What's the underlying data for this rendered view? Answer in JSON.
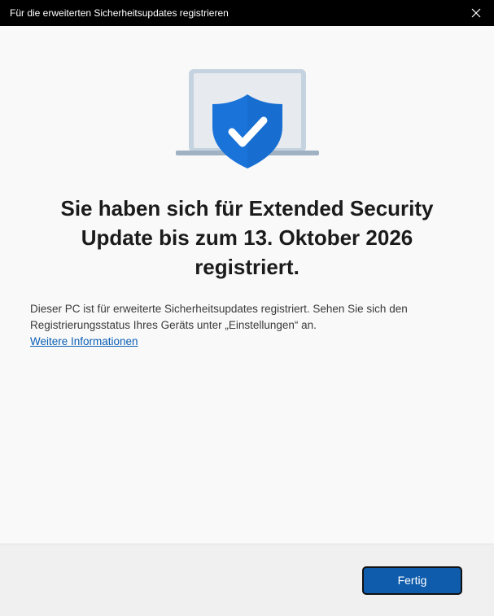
{
  "window": {
    "title": "Für die erweiterten Sicherheitsupdates registrieren",
    "close_icon": "close-icon"
  },
  "hero": {
    "icon": "laptop-shield-check-icon",
    "colors": {
      "shield": "#1a73d9",
      "laptop_frame": "#b9c9d8",
      "check": "#ffffff"
    }
  },
  "main": {
    "headline": "Sie haben sich für Extended Security Update bis zum 13. Oktober 2026 registriert.",
    "description": "Dieser PC ist für erweiterte Sicherheitsupdates registriert. Sehen Sie sich den Registrierungsstatus Ihres Geräts unter „Einstellungen“ an.",
    "link": "Weitere Informationen"
  },
  "footer": {
    "done_label": "Fertig"
  },
  "colors": {
    "accent": "#0f5cac",
    "link": "#0a5fb4",
    "titlebar": "#000000"
  }
}
